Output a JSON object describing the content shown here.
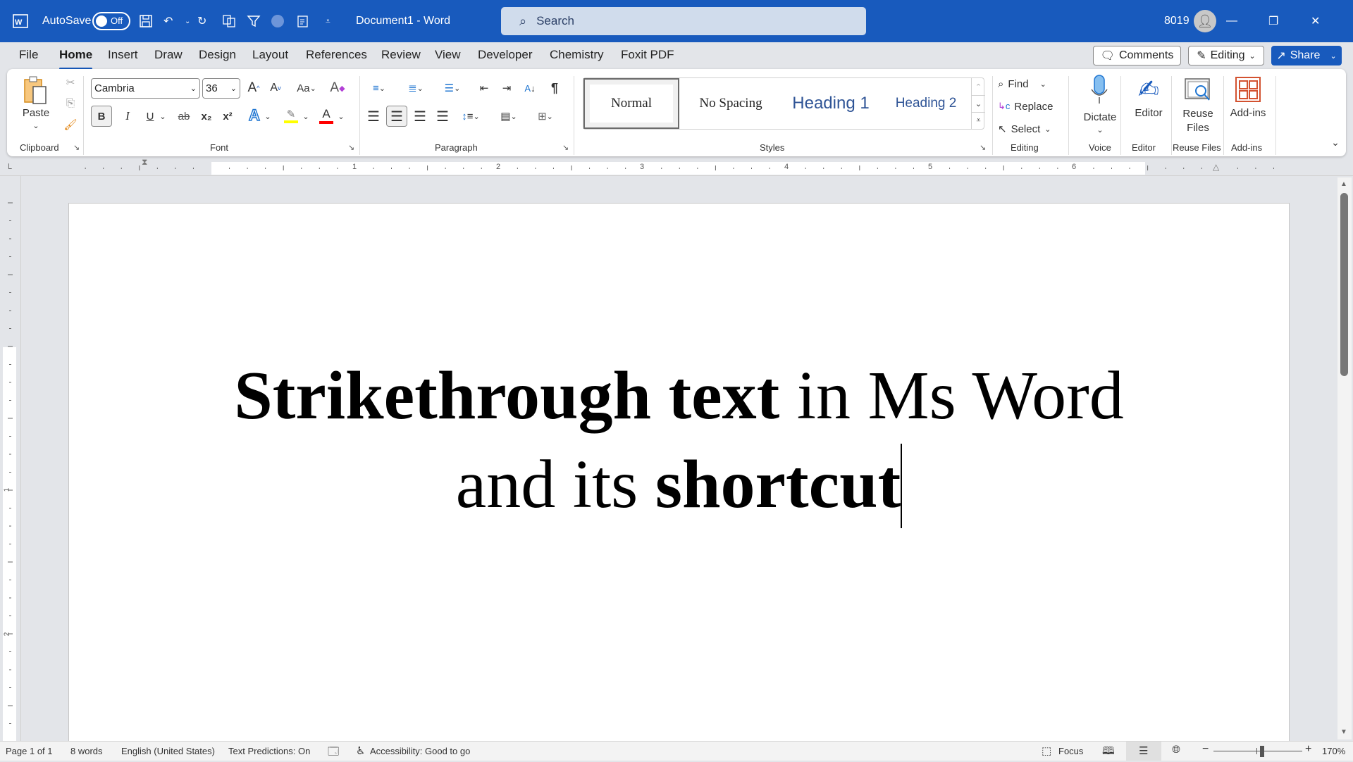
{
  "titlebar": {
    "autosave_label": "AutoSave",
    "autosave_state": "Off",
    "doc_title": "Document1  -  Word",
    "search_placeholder": "Search",
    "user": "8019",
    "icons": {
      "app": "word-icon",
      "save": "save-icon",
      "undo": "undo-icon",
      "redo": "redo-icon",
      "more": "customize-qat-icon"
    }
  },
  "tabs": [
    "File",
    "Home",
    "Insert",
    "Draw",
    "Design",
    "Layout",
    "References",
    "Review",
    "View",
    "Developer",
    "Chemistry",
    "Foxit PDF"
  ],
  "active_tab": "Home",
  "right_buttons": {
    "comments": "Comments",
    "editing": "Editing",
    "share": "Share"
  },
  "ribbon": {
    "clipboard": {
      "paste": "Paste",
      "label": "Clipboard"
    },
    "font": {
      "family": "Cambria",
      "size": "36",
      "label": "Font",
      "bold": "B",
      "italic": "I",
      "underline": "U",
      "strike": "ab",
      "sub": "x₂",
      "sup": "x²",
      "case": "Aa",
      "highlight_color": "#ffff00",
      "font_color": "#ff0000"
    },
    "paragraph": {
      "label": "Paragraph",
      "pilcrow": "¶"
    },
    "styles": {
      "label": "Styles",
      "items": [
        "Normal",
        "No Spacing",
        "Heading 1",
        "Heading 2"
      ],
      "selected": "Normal"
    },
    "editing": {
      "label": "Editing",
      "find": "Find",
      "replace": "Replace",
      "select": "Select"
    },
    "voice": {
      "label": "Voice",
      "dictate": "Dictate"
    },
    "editor": {
      "label": "Editor",
      "button": "Editor"
    },
    "reuse": {
      "label": "Reuse Files",
      "button1": "Reuse",
      "button2": "Files"
    },
    "addins": {
      "label": "Add-ins",
      "button": "Add-ins"
    }
  },
  "ruler": {
    "numbers": [
      "1",
      "2",
      "3",
      "4",
      "5",
      "6"
    ]
  },
  "document": {
    "line1_bold": "Strikethrough text",
    "line1_rest": " in Ms Word",
    "line2_plain": "and its ",
    "line2_bold": "shortcut"
  },
  "status": {
    "page": "Page 1 of 1",
    "words": "8 words",
    "language": "English (United States)",
    "predictions": "Text Predictions: On",
    "accessibility": "Accessibility: Good to go",
    "focus": "Focus",
    "zoom": "170%",
    "zoom_fraction": 0.55
  },
  "colors": {
    "brand": "#185abd",
    "accent_orange": "#d35230"
  }
}
